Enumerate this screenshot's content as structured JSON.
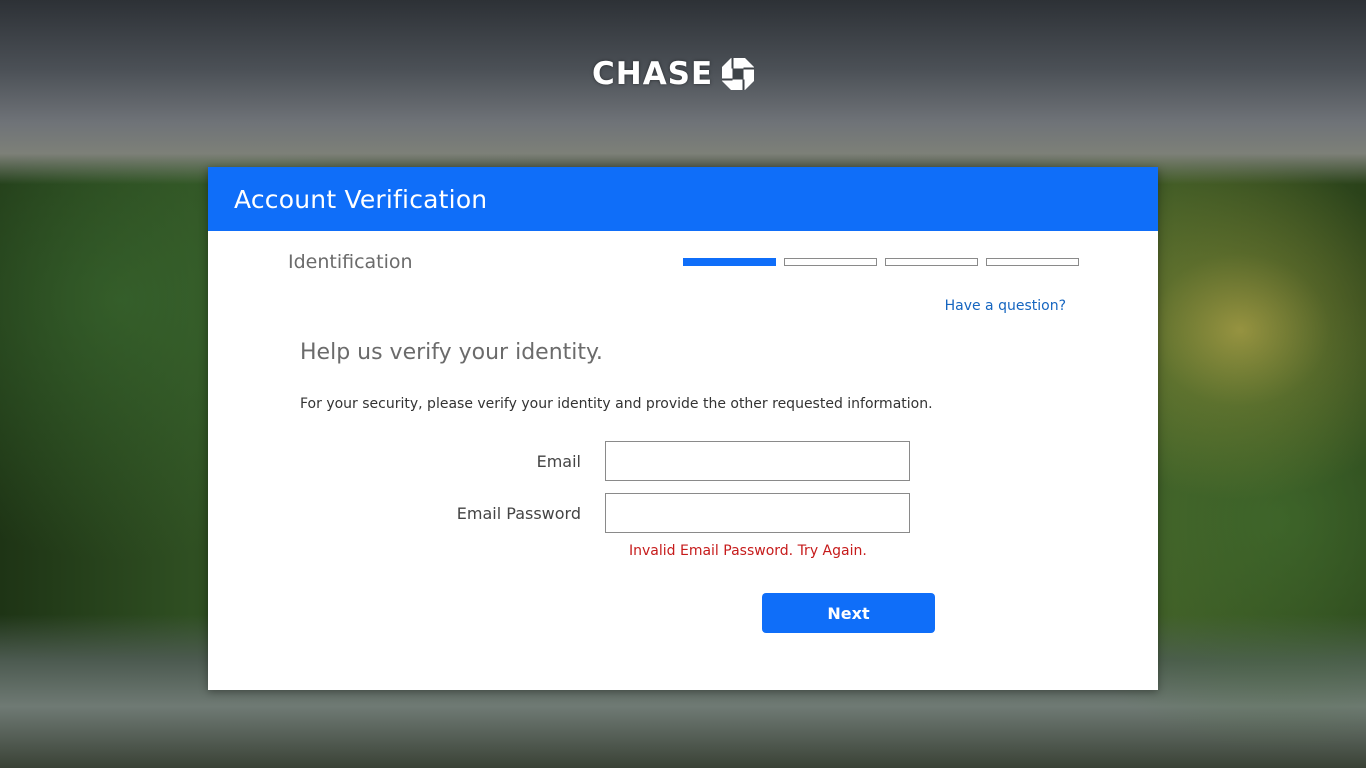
{
  "brand": {
    "name": "CHASE",
    "logo_icon": "chase-octagon-icon",
    "primary_color": "#0f6ef9"
  },
  "panel": {
    "title": "Account Verification",
    "step_label": "Identification",
    "steps_total": 4,
    "step_current": 1,
    "help_link": "Have a question?",
    "heading": "Help us verify your identity.",
    "description": "For your security, please verify your identity and provide the other requested information."
  },
  "form": {
    "email_label": "Email",
    "email_value": "",
    "password_label": "Email Password",
    "password_value": "",
    "error_message": "Invalid Email Password. Try Again.",
    "error_color": "#c61b1b",
    "next_label": "Next"
  }
}
